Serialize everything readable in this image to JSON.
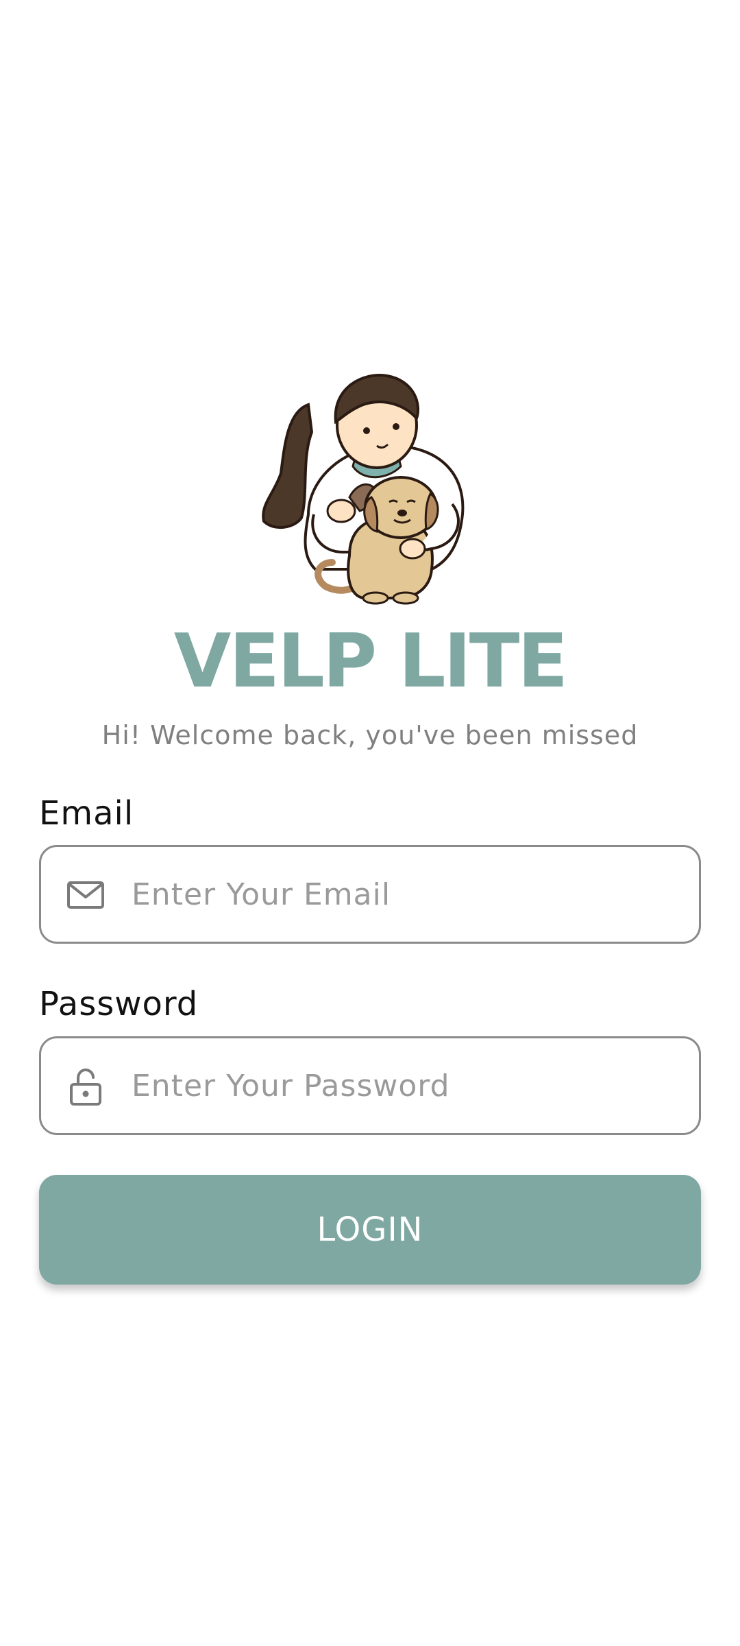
{
  "app": {
    "title": "VELP LITE",
    "subtitle": "Hi! Welcome back, you've been missed"
  },
  "illustration": {
    "icon": "girl-hugging-dog-illustration"
  },
  "form": {
    "email": {
      "label": "Email",
      "placeholder": "Enter Your Email",
      "value": "",
      "icon": "mail-icon"
    },
    "password": {
      "label": "Password",
      "placeholder": "Enter Your Password",
      "value": "",
      "icon": "lock-icon"
    },
    "login_label": "LOGIN"
  },
  "colors": {
    "accent": "#7FA8A2",
    "subtitle": "#808080",
    "border": "#8A8A8A"
  }
}
